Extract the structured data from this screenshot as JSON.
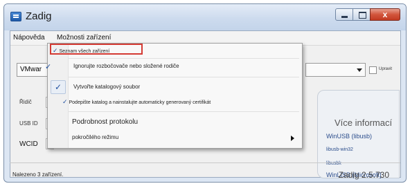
{
  "window": {
    "title": "Zadig"
  },
  "caption": {
    "close_glyph": "x"
  },
  "menubar": {
    "help": "Nápověda",
    "options": "Možnosti zařízení"
  },
  "device_combo": {
    "value": "VMwar"
  },
  "edit_label": "Upravit",
  "labels": {
    "driver": "Řidič",
    "usb_id": "USB ID",
    "wcid": "WCID"
  },
  "info": {
    "title": "Více informací",
    "links": [
      "WinUSB (libusb)",
      "libusb-win32",
      "libusbk",
      "WinLISB (Microsoft]"
    ]
  },
  "dropdown": {
    "items": [
      {
        "label": "Seznam všech zařízení",
        "checked": true,
        "check_style": "inline"
      },
      {
        "label": "Ignorujte rozbočovače nebo složené rodiče",
        "checked": true,
        "check_style": "overflow"
      },
      {
        "label": "Vytvořte katalogový soubor",
        "checked": true,
        "check_style": "box"
      },
      {
        "label": "Podepište katalog a nainstalujte automaticky generovaný certifikát",
        "checked": true,
        "check_style": "inline"
      },
      {
        "label": "Podrobnost protokolu"
      },
      {
        "label": "pokročilého režimu",
        "has_submenu": true
      }
    ]
  },
  "status": {
    "left": "Nalezeno 3 zařízení.",
    "right": "Zadig 2.5.730"
  },
  "colors": {
    "highlight_border": "#d43a33",
    "check": "#1f4f9f",
    "title_bar": "#cddbee"
  }
}
